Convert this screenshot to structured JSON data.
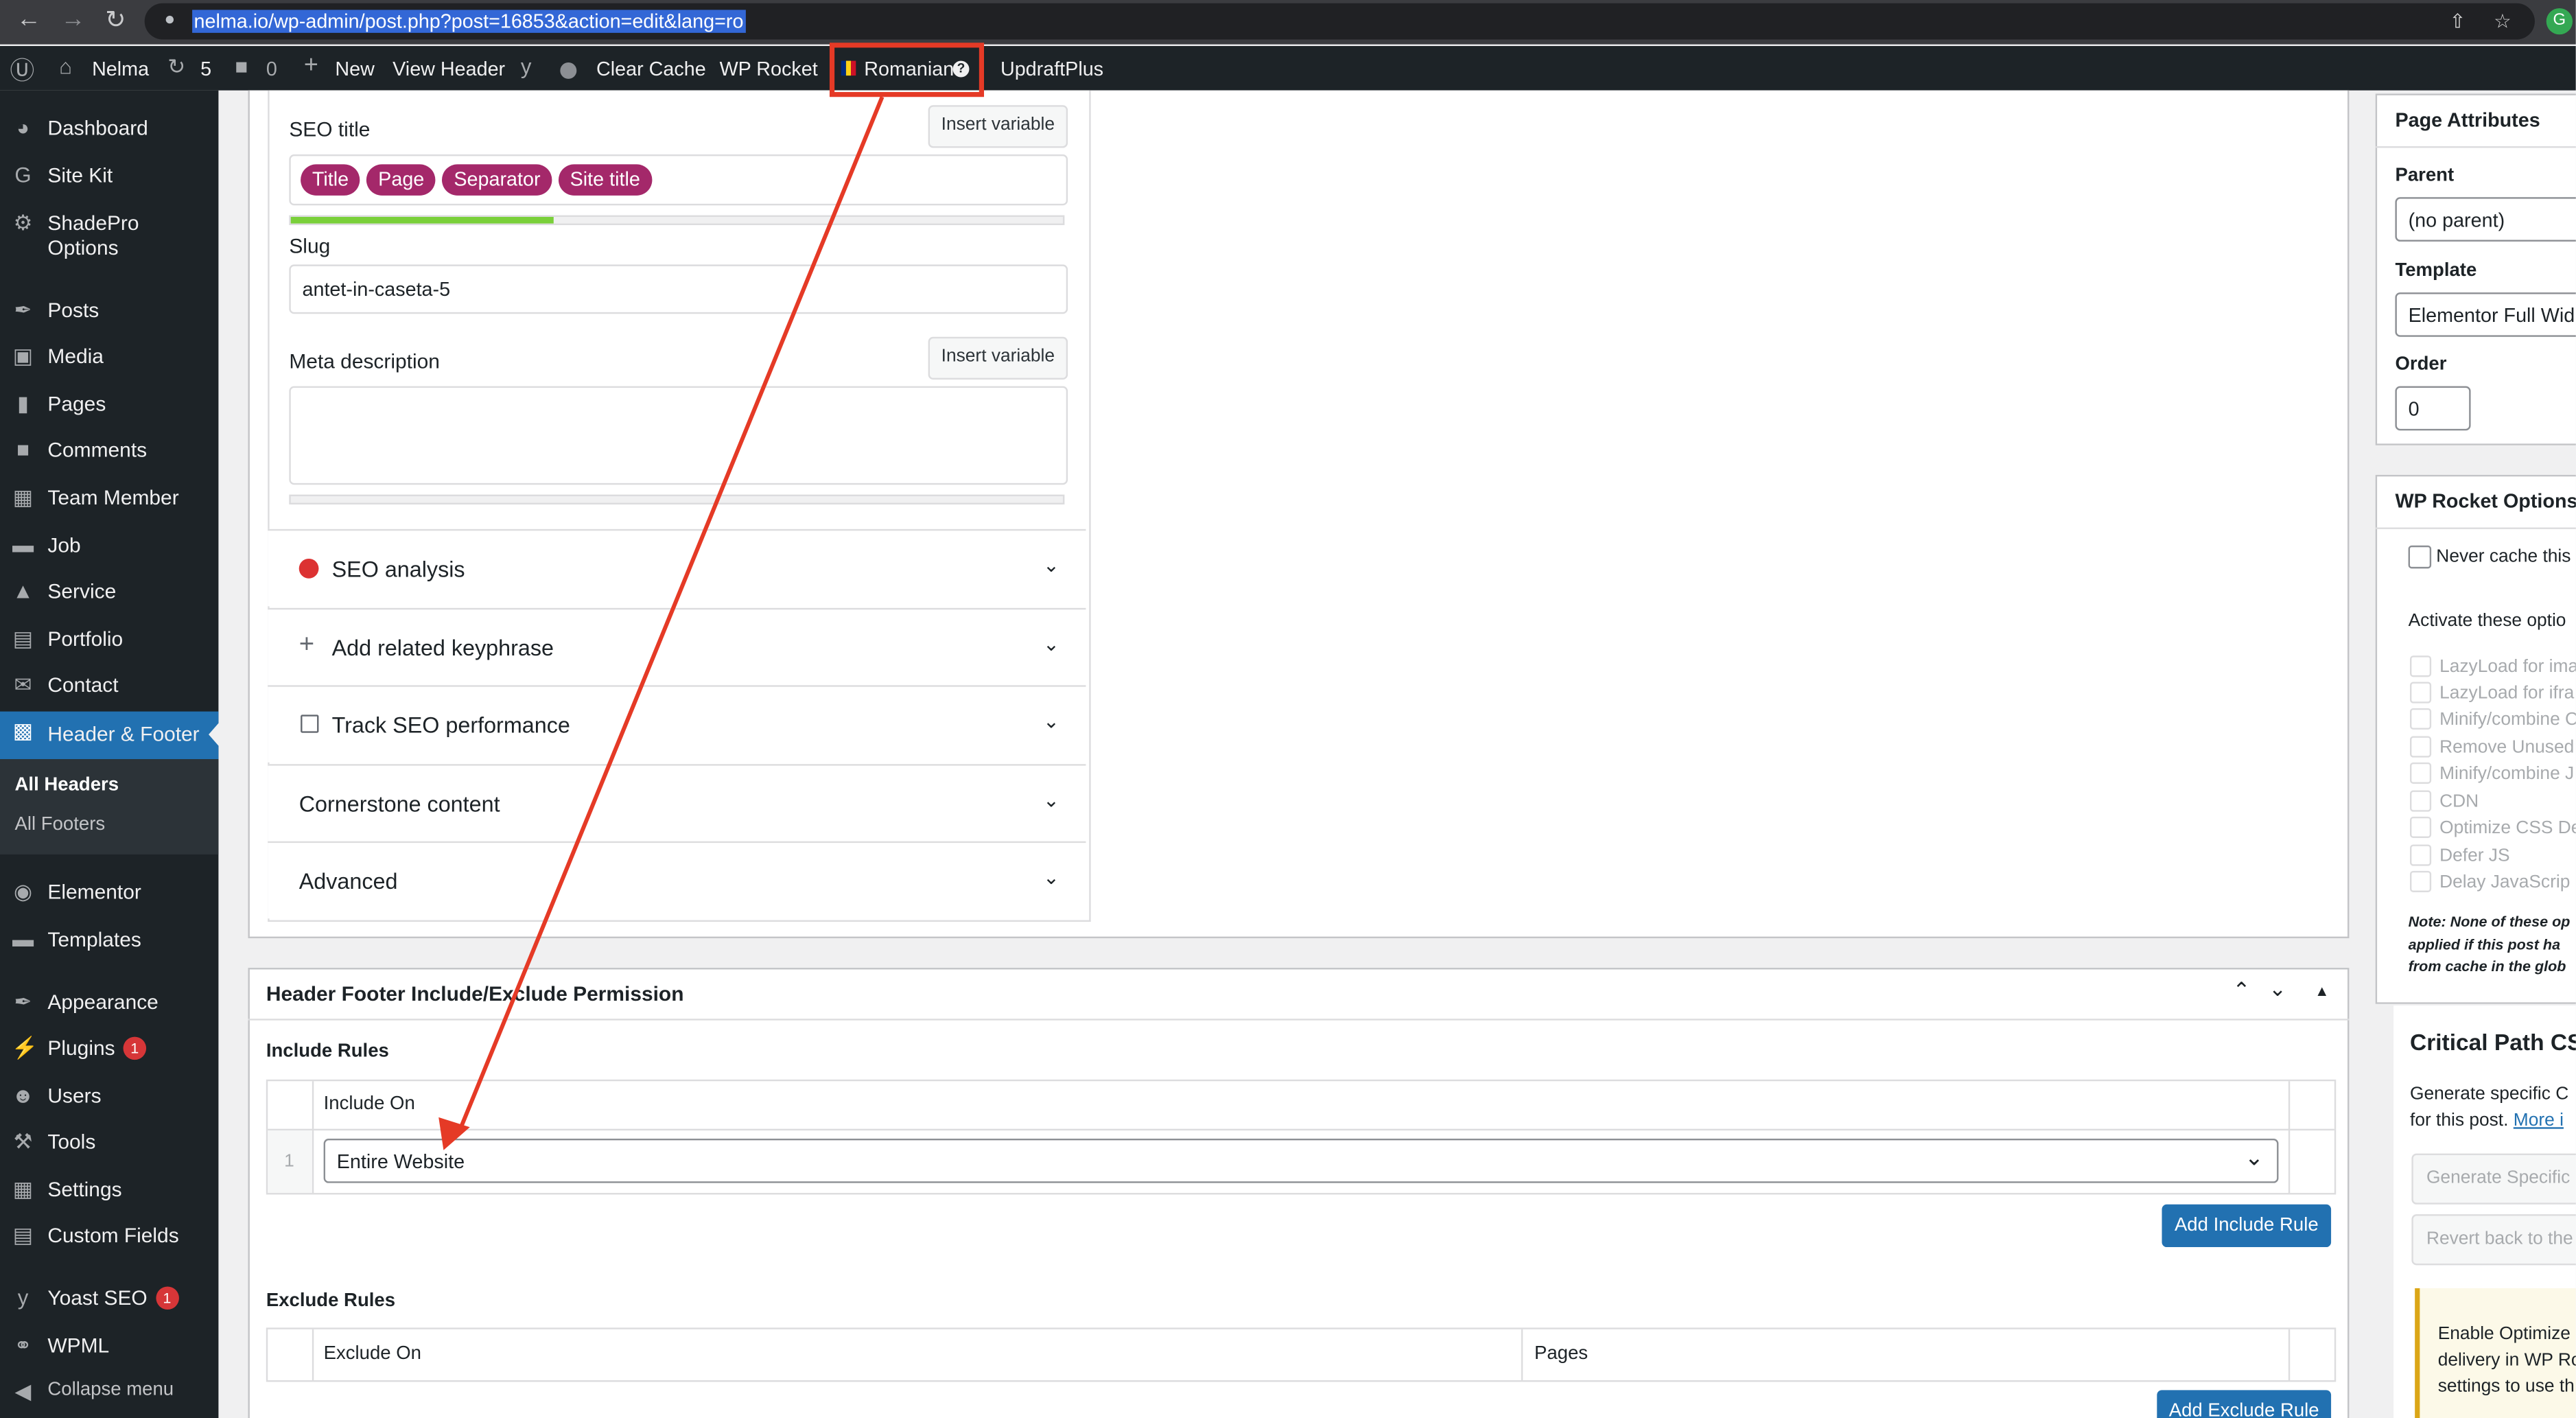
{
  "browser": {
    "url": "nelma.io/wp-admin/post.php?post=16853&action=edit&lang=ro",
    "profile_initial": "G"
  },
  "adminbar": {
    "site_name": "Nelma",
    "updates_count": "5",
    "comments_count": "0",
    "new_label": "New",
    "view_header": "View Header",
    "clear_cache": "Clear Cache",
    "wp_rocket": "WP Rocket",
    "language": "Romanian",
    "updraft": "UpdraftPlus"
  },
  "sidebar": {
    "items": [
      {
        "label": "Dashboard"
      },
      {
        "label": "Site Kit"
      },
      {
        "label": "ShadePro Options"
      },
      {
        "label": "Posts"
      },
      {
        "label": "Media"
      },
      {
        "label": "Pages"
      },
      {
        "label": "Comments"
      },
      {
        "label": "Team Member"
      },
      {
        "label": "Job"
      },
      {
        "label": "Service"
      },
      {
        "label": "Portfolio"
      },
      {
        "label": "Contact"
      },
      {
        "label": "Header & Footer"
      },
      {
        "label": "Elementor"
      },
      {
        "label": "Templates"
      },
      {
        "label": "Appearance"
      },
      {
        "label": "Plugins",
        "badge": "1"
      },
      {
        "label": "Users"
      },
      {
        "label": "Tools"
      },
      {
        "label": "Settings"
      },
      {
        "label": "Custom Fields"
      },
      {
        "label": "Yoast SEO",
        "badge": "1"
      },
      {
        "label": "WPML"
      },
      {
        "label": "Collapse menu"
      }
    ],
    "submenu": [
      "All Headers",
      "All Footers"
    ]
  },
  "seo": {
    "seo_title_label": "SEO title",
    "insert_variable": "Insert variable",
    "pills": [
      "Title",
      "Page",
      "Separator",
      "Site title"
    ],
    "title_progress": 0.34,
    "slug_label": "Slug",
    "slug_value": "antet-in-caseta-5",
    "meta_label": "Meta description",
    "accordions": [
      "SEO analysis",
      "Add related keyphrase",
      "Track SEO performance",
      "Cornerstone content",
      "Advanced"
    ]
  },
  "hf": {
    "title": "Header Footer Include/Exclude Permission",
    "include_rules": "Include Rules",
    "include_on": "Include On",
    "row_num": "1",
    "include_value": "Entire Website",
    "add_include": "Add Include Rule",
    "exclude_rules": "Exclude Rules",
    "exclude_on": "Exclude On",
    "pages": "Pages",
    "add_exclude": "Add Exclude Rule"
  },
  "page_attributes": {
    "title": "Page Attributes",
    "parent_label": "Parent",
    "parent_value": "(no parent)",
    "template_label": "Template",
    "template_value": "Elementor Full Wid",
    "order_label": "Order",
    "order_value": "0"
  },
  "wp_rocket": {
    "title": "WP Rocket Options",
    "never_cache": "Never cache this",
    "activate": "Activate these optio",
    "options": [
      "LazyLoad for ima",
      "LazyLoad for ifra",
      "Minify/combine C",
      "Remove Unused",
      "Minify/combine J",
      "CDN",
      "Optimize CSS De",
      "Defer JS",
      "Delay JavaScrip"
    ],
    "note_lines": [
      "Note: None of these op",
      "applied if this post ha",
      "from cache in the glob"
    ]
  },
  "critical_css": {
    "title": "Critical Path CS",
    "desc_1": "Generate specific C",
    "desc_2": "for this post.",
    "more": "More i",
    "generate_btn": "Generate Specific",
    "revert_btn": "Revert back to the",
    "notice_lines": [
      "Enable Optimize",
      "delivery in WP Ro",
      "settings to use th"
    ]
  },
  "colors": {
    "accent": "#2271b1",
    "annotation": "#e53a26",
    "pill": "#a4286a",
    "adminbar": "#1d2327"
  }
}
